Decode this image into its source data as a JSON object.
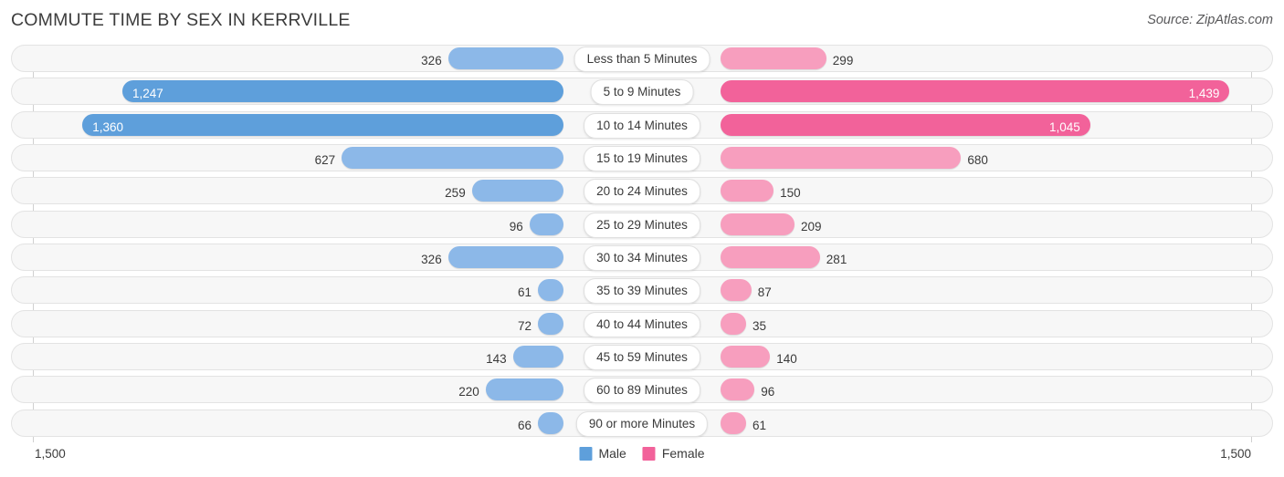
{
  "header": {
    "title": "COMMUTE TIME BY SEX IN KERRVILLE",
    "source": "Source: ZipAtlas.com"
  },
  "footer": {
    "axis_min_label": "1,500",
    "axis_max_label": "1,500",
    "legend": [
      {
        "label": "Male",
        "color": "#5e9fdb"
      },
      {
        "label": "Female",
        "color": "#f2629a"
      }
    ]
  },
  "colors": {
    "male_light": "#8cb8e8",
    "male_strong": "#5e9fdb",
    "female_light": "#f79ebe",
    "female_strong": "#f2629a",
    "track_fill": "#f7f7f7",
    "track_border": "#e3e3e3"
  },
  "chart_data": {
    "type": "bar",
    "subtype": "diverging-bidirectional",
    "title": "COMMUTE TIME BY SEX IN KERRVILLE",
    "xlabel": "",
    "ylabel": "",
    "axis_max": 1500,
    "axis_min_label": "1,500",
    "axis_max_label": "1,500",
    "grid": false,
    "legend_position": "bottom-center",
    "categories": [
      "Less than 5 Minutes",
      "5 to 9 Minutes",
      "10 to 14 Minutes",
      "15 to 19 Minutes",
      "20 to 24 Minutes",
      "25 to 29 Minutes",
      "30 to 34 Minutes",
      "35 to 39 Minutes",
      "40 to 44 Minutes",
      "45 to 59 Minutes",
      "60 to 89 Minutes",
      "90 or more Minutes"
    ],
    "series": [
      {
        "name": "Male",
        "side": "left",
        "values": [
          326,
          1247,
          1360,
          627,
          259,
          96,
          326,
          61,
          72,
          143,
          220,
          66
        ],
        "labels": [
          "326",
          "1,247",
          "1,360",
          "627",
          "259",
          "96",
          "326",
          "61",
          "72",
          "143",
          "220",
          "66"
        ]
      },
      {
        "name": "Female",
        "side": "right",
        "values": [
          299,
          1439,
          1045,
          680,
          150,
          209,
          281,
          87,
          35,
          140,
          96,
          61
        ],
        "labels": [
          "299",
          "1,439",
          "1,045",
          "680",
          "150",
          "209",
          "281",
          "87",
          "35",
          "140",
          "96",
          "61"
        ]
      }
    ]
  }
}
